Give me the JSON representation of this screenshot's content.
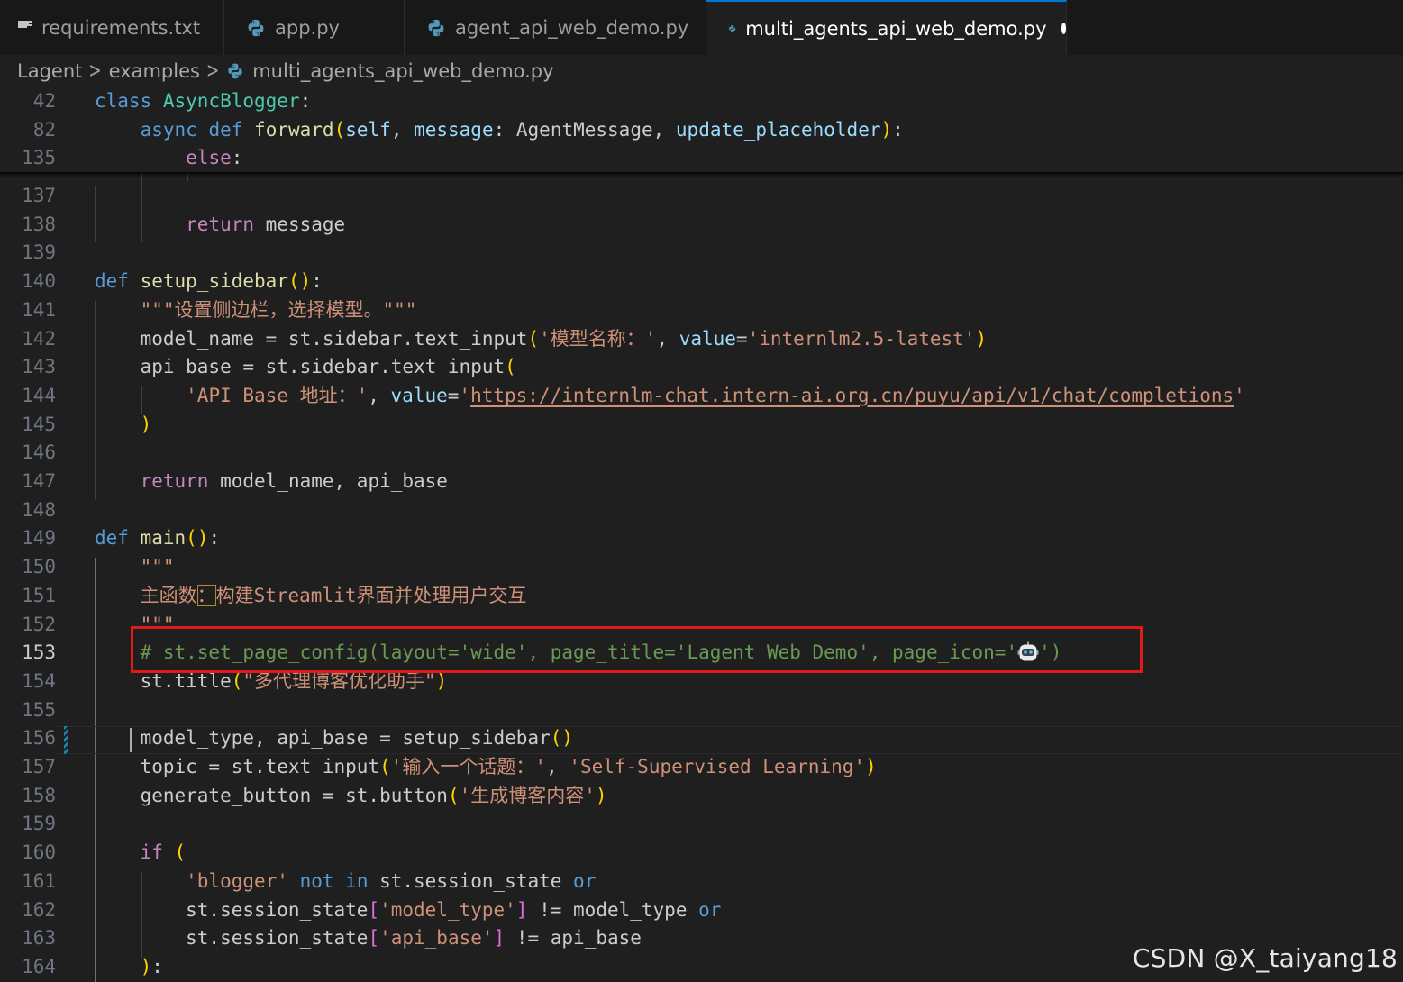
{
  "tabs": [
    {
      "label": "requirements.txt",
      "icon": "text-file-icon",
      "active": false
    },
    {
      "label": "app.py",
      "icon": "python-icon",
      "active": false
    },
    {
      "label": "agent_api_web_demo.py",
      "icon": "python-icon",
      "active": false
    },
    {
      "label": "multi_agents_api_web_demo.py",
      "icon": "python-icon",
      "active": true,
      "modified": true
    }
  ],
  "breadcrumb": {
    "items": [
      "Lagent",
      "examples",
      "multi_agents_api_web_demo.py"
    ],
    "separator": ">"
  },
  "editor": {
    "current_line": "153",
    "sticky_lines": [
      {
        "number": "42",
        "tokens": [
          [
            "kw",
            "class"
          ],
          [
            "",
            " "
          ],
          [
            "cls",
            "AsyncBlogger"
          ],
          [
            "",
            ":"
          ]
        ]
      },
      {
        "number": "82",
        "tokens": [
          [
            "",
            "    "
          ],
          [
            "kw",
            "async"
          ],
          [
            "",
            " "
          ],
          [
            "kw",
            "def"
          ],
          [
            "",
            " "
          ],
          [
            "fn",
            "forward"
          ],
          [
            "p1",
            "("
          ],
          [
            "prm",
            "self"
          ],
          [
            "",
            ", "
          ],
          [
            "prm",
            "message"
          ],
          [
            "",
            ": AgentMessage, "
          ],
          [
            "prm",
            "update_placeholder"
          ],
          [
            "p1",
            ")"
          ],
          [
            "",
            ":"
          ]
        ]
      },
      {
        "number": "135",
        "tokens": [
          [
            "",
            "        "
          ],
          [
            "ctl",
            "else"
          ],
          [
            "",
            ":"
          ]
        ]
      }
    ],
    "lines": [
      {
        "number": "137",
        "tokens": []
      },
      {
        "number": "138",
        "tokens": [
          [
            "",
            "        "
          ],
          [
            "ctl",
            "return"
          ],
          [
            "",
            " message"
          ]
        ]
      },
      {
        "number": "139",
        "tokens": []
      },
      {
        "number": "140",
        "tokens": [
          [
            "kw",
            "def"
          ],
          [
            "",
            " "
          ],
          [
            "fn",
            "setup_sidebar"
          ],
          [
            "p1",
            "()"
          ],
          [
            "",
            ":"
          ]
        ]
      },
      {
        "number": "141",
        "tokens": [
          [
            "",
            "    "
          ],
          [
            "str",
            "\"\"\"设置侧边栏，选择模型。\"\"\""
          ]
        ]
      },
      {
        "number": "142",
        "tokens": [
          [
            "",
            "    model_name = st.sidebar.text_input"
          ],
          [
            "p1",
            "("
          ],
          [
            "str",
            "'模型名称：'"
          ],
          [
            "",
            ", "
          ],
          [
            "prm",
            "value"
          ],
          [
            "",
            "="
          ],
          [
            "str",
            "'internlm2.5-latest'"
          ],
          [
            "p1",
            ")"
          ]
        ]
      },
      {
        "number": "143",
        "tokens": [
          [
            "",
            "    api_base = st.sidebar.text_input"
          ],
          [
            "p1",
            "("
          ]
        ]
      },
      {
        "number": "144",
        "tokens": [
          [
            "",
            "        "
          ],
          [
            "str",
            "'API Base 地址：'"
          ],
          [
            "",
            ", "
          ],
          [
            "prm",
            "value"
          ],
          [
            "",
            "="
          ],
          [
            "str",
            "'"
          ],
          [
            "str link",
            "https://internlm-chat.intern-ai.org.cn/puyu/api/v1/chat/completions"
          ],
          [
            "str",
            "'"
          ]
        ]
      },
      {
        "number": "145",
        "tokens": [
          [
            "",
            "    "
          ],
          [
            "p1",
            ")"
          ]
        ]
      },
      {
        "number": "146",
        "tokens": []
      },
      {
        "number": "147",
        "tokens": [
          [
            "",
            "    "
          ],
          [
            "ctl",
            "return"
          ],
          [
            "",
            " model_name, api_base"
          ]
        ]
      },
      {
        "number": "148",
        "tokens": []
      },
      {
        "number": "149",
        "tokens": [
          [
            "kw",
            "def"
          ],
          [
            "",
            " "
          ],
          [
            "fn",
            "main"
          ],
          [
            "p1",
            "()"
          ],
          [
            "",
            ":"
          ]
        ]
      },
      {
        "number": "150",
        "tokens": [
          [
            "",
            "    "
          ],
          [
            "str",
            "\"\"\""
          ]
        ]
      },
      {
        "number": "151",
        "tokens": [
          [
            "",
            "    "
          ],
          [
            "str",
            "主函数"
          ],
          [
            "str boxed",
            "："
          ],
          [
            "str",
            "构建Streamlit界面并处理用户交互"
          ]
        ]
      },
      {
        "number": "152",
        "tokens": [
          [
            "",
            "    "
          ],
          [
            "str",
            "\"\"\""
          ]
        ]
      },
      {
        "number": "153",
        "tokens": [
          [
            "",
            "    "
          ],
          [
            "cmt",
            "# st.set_page_config(layout='wide', page_title='Lagent Web Demo', page_icon='"
          ],
          [
            "robot",
            ""
          ],
          [
            "cmt",
            "')"
          ]
        ]
      },
      {
        "number": "154",
        "tokens": [
          [
            "",
            "    st.title"
          ],
          [
            "p1",
            "("
          ],
          [
            "str",
            "\"多代理博客优化助手\""
          ],
          [
            "p1",
            ")"
          ]
        ]
      },
      {
        "number": "155",
        "tokens": []
      },
      {
        "number": "156",
        "tokens": [
          [
            "",
            "    model_type, api_base = setup_sidebar"
          ],
          [
            "p1",
            "()"
          ]
        ]
      },
      {
        "number": "157",
        "tokens": [
          [
            "",
            "    topic = st.text_input"
          ],
          [
            "p1",
            "("
          ],
          [
            "str",
            "'输入一个话题：'"
          ],
          [
            "",
            ", "
          ],
          [
            "str",
            "'Self-Supervised Learning'"
          ],
          [
            "p1",
            ")"
          ]
        ]
      },
      {
        "number": "158",
        "tokens": [
          [
            "",
            "    generate_button = st.button"
          ],
          [
            "p1",
            "("
          ],
          [
            "str",
            "'生成博客内容'"
          ],
          [
            "p1",
            ")"
          ]
        ]
      },
      {
        "number": "159",
        "tokens": []
      },
      {
        "number": "160",
        "tokens": [
          [
            "",
            "    "
          ],
          [
            "ctl",
            "if"
          ],
          [
            "",
            " "
          ],
          [
            "p1",
            "("
          ]
        ]
      },
      {
        "number": "161",
        "tokens": [
          [
            "",
            "        "
          ],
          [
            "str",
            "'blogger'"
          ],
          [
            "",
            " "
          ],
          [
            "kw",
            "not in"
          ],
          [
            "",
            " st.session_state "
          ],
          [
            "kw",
            "or"
          ]
        ]
      },
      {
        "number": "162",
        "tokens": [
          [
            "",
            "        st.session_state"
          ],
          [
            "p2",
            "["
          ],
          [
            "str",
            "'model_type'"
          ],
          [
            "p2",
            "]"
          ],
          [
            "",
            " != model_type "
          ],
          [
            "kw",
            "or"
          ]
        ]
      },
      {
        "number": "163",
        "tokens": [
          [
            "",
            "        st.session_state"
          ],
          [
            "p2",
            "["
          ],
          [
            "str",
            "'api_base'"
          ],
          [
            "p2",
            "]"
          ],
          [
            "",
            " != api_base"
          ]
        ]
      },
      {
        "number": "164",
        "tokens": [
          [
            "",
            "    "
          ],
          [
            "p1",
            ")"
          ],
          [
            "",
            ":"
          ]
        ]
      }
    ]
  },
  "watermark": "CSDN @X_taiyang18",
  "colors": {
    "background": "#1f1f1f",
    "tab_active_border": "#0078d4",
    "highlight_box": "#e01919",
    "keyword": "#569cd6",
    "string": "#ce9178",
    "comment": "#6a9955"
  }
}
